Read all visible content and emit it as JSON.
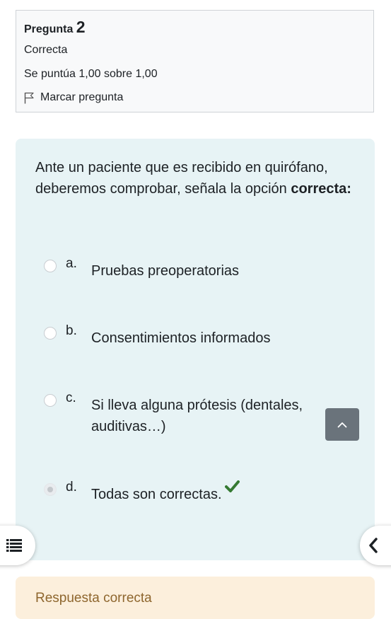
{
  "question": {
    "label": "Pregunta",
    "number": "2",
    "state": "Correcta",
    "grade": "Se puntúa 1,00 sobre 1,00",
    "flag_label": "Marcar pregunta",
    "text_main": "Ante un paciente que es recibido en quirófano, deberemos comprobar, señala la opción ",
    "text_bold": "correcta:"
  },
  "answers": [
    {
      "letter": "a.",
      "text": "Pruebas preoperatorias",
      "selected": false
    },
    {
      "letter": "b.",
      "text": "Consentimientos informados",
      "selected": false
    },
    {
      "letter": "c.",
      "text": "Si lleva alguna prótesis (dentales, auditivas…)",
      "selected": false
    },
    {
      "letter": "d.",
      "text": "Todas son correctas.",
      "selected": true,
      "marked_correct": true
    }
  ],
  "feedback": {
    "text": "Respuesta correcta"
  },
  "icons": {
    "flag": "flag-icon",
    "correct": "check-icon",
    "scroll_top": "chevron-up-icon",
    "course_index": "list-icon",
    "blocks_drawer": "chevron-left-icon"
  },
  "colors": {
    "content_bg": "#e7f3f5",
    "feedback_bg": "#fcefdc",
    "correct_check": "#357a32",
    "scroll_button": "#6a737b"
  }
}
